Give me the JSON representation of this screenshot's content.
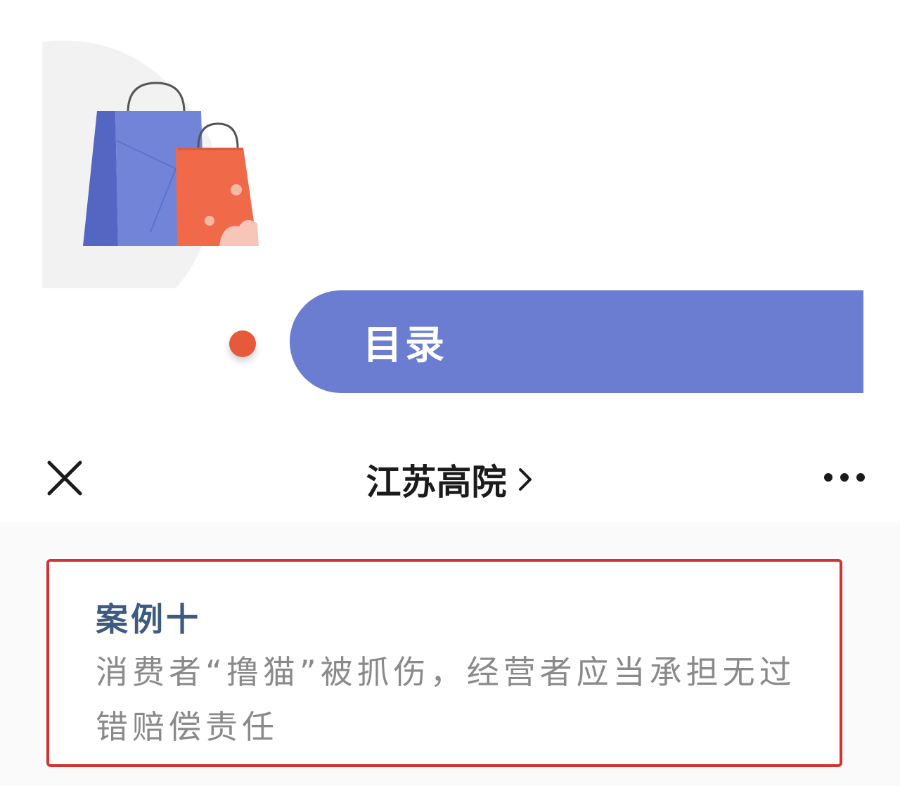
{
  "banner": {
    "title": "目录"
  },
  "nav": {
    "title": "江苏高院",
    "close_icon": "close-icon",
    "chevron_icon": "chevron-right-icon",
    "more_icon": "more-icon"
  },
  "card": {
    "case_number": "案例十",
    "case_title": "消费者“撸猫”被抓伤，经营者应当承担无过错赔偿责任"
  },
  "colors": {
    "banner_blue": "#6a7dd0",
    "accent_orange": "#e6593a",
    "card_border_red": "#d2332f",
    "case_number_blue": "#3d5a80",
    "case_title_gray": "#8a8a8a"
  }
}
